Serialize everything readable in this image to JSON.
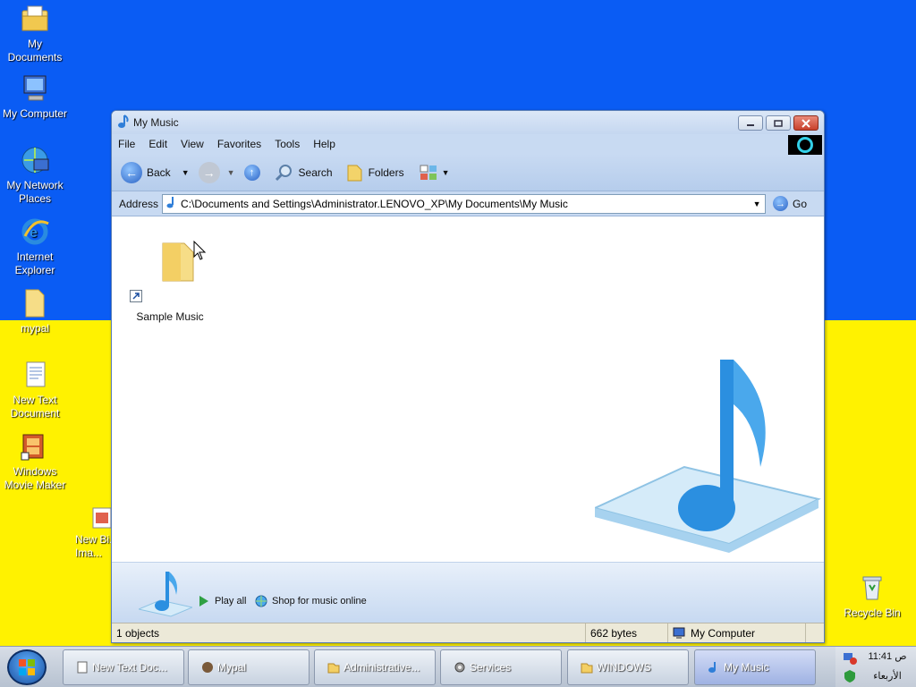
{
  "desktop": {
    "icons": [
      {
        "label": "My Documents"
      },
      {
        "label": "My Computer"
      },
      {
        "label": "My Network Places"
      },
      {
        "label": "Internet Explorer"
      },
      {
        "label": "mypal"
      },
      {
        "label": "New Text Document"
      },
      {
        "label": "Windows Movie Maker"
      },
      {
        "label": "New Bi... Ima..."
      },
      {
        "label": "Recycle Bin"
      }
    ]
  },
  "window": {
    "title": "My Music",
    "menu": [
      "File",
      "Edit",
      "View",
      "Favorites",
      "Tools",
      "Help"
    ],
    "toolbar": {
      "back": "Back",
      "search": "Search",
      "folders": "Folders"
    },
    "address": {
      "label": "Address",
      "value": "C:\\Documents and Settings\\Administrator.LENOVO_XP\\My Documents\\My Music",
      "go": "Go"
    },
    "items": [
      {
        "label": "Sample Music"
      }
    ],
    "tasks": {
      "play_all": "Play all",
      "shop": "Shop for music online"
    },
    "status": {
      "objects": "1 objects",
      "size": "662 bytes",
      "location": "My Computer"
    }
  },
  "taskbar": {
    "tasks": [
      {
        "label": "New Text Doc..."
      },
      {
        "label": "Mypal"
      },
      {
        "label": "Administrative..."
      },
      {
        "label": "Services"
      },
      {
        "label": "WINDOWS"
      },
      {
        "label": "My Music"
      }
    ],
    "clock": {
      "time": "11:41",
      "ampm": "ص",
      "day": "الأربعاء"
    }
  },
  "colors": {
    "desktop_top": "#0a5cf4",
    "desktop_bottom": "#fff200",
    "window_chrome": "#c8daf2"
  }
}
